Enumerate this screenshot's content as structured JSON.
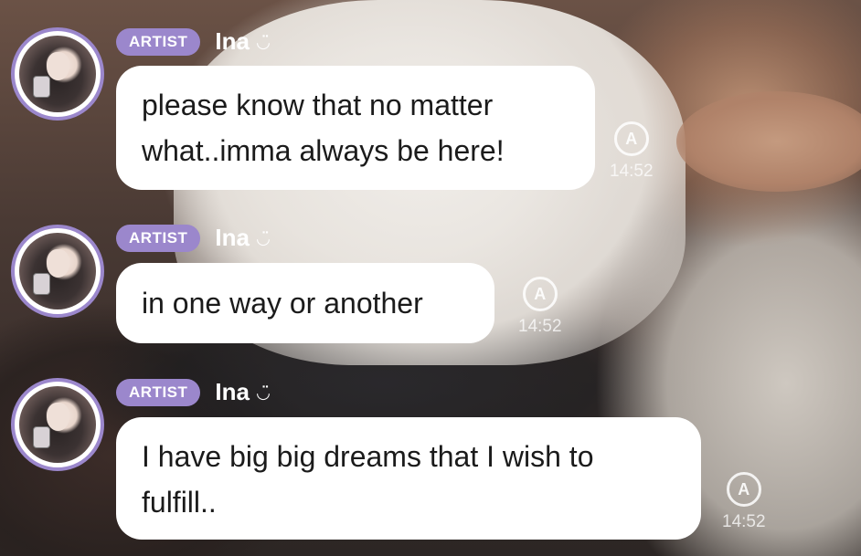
{
  "messages": [
    {
      "badge": "ARTIST",
      "name": "Ina",
      "text_lines": [
        "please know that no matter",
        "what..imma always be here!"
      ],
      "time": "14:52",
      "translate_glyph": "A"
    },
    {
      "badge": "ARTIST",
      "name": "Ina",
      "text_lines": [
        "in one way or another"
      ],
      "time": "14:52",
      "translate_glyph": "A"
    },
    {
      "badge": "ARTIST",
      "name": "Ina",
      "text_lines": [
        "I have big big dreams that I wish to",
        "fulfill.."
      ],
      "time": "14:52",
      "translate_glyph": "A"
    }
  ],
  "icons": {
    "smile": "smile-icon",
    "translate": "translate-icon",
    "avatar": "avatar"
  },
  "colors": {
    "badge": "#9b87cc",
    "bubble": "#ffffff",
    "avatar_ring": "#9b87cc"
  },
  "smile_glyph": "◡̈"
}
